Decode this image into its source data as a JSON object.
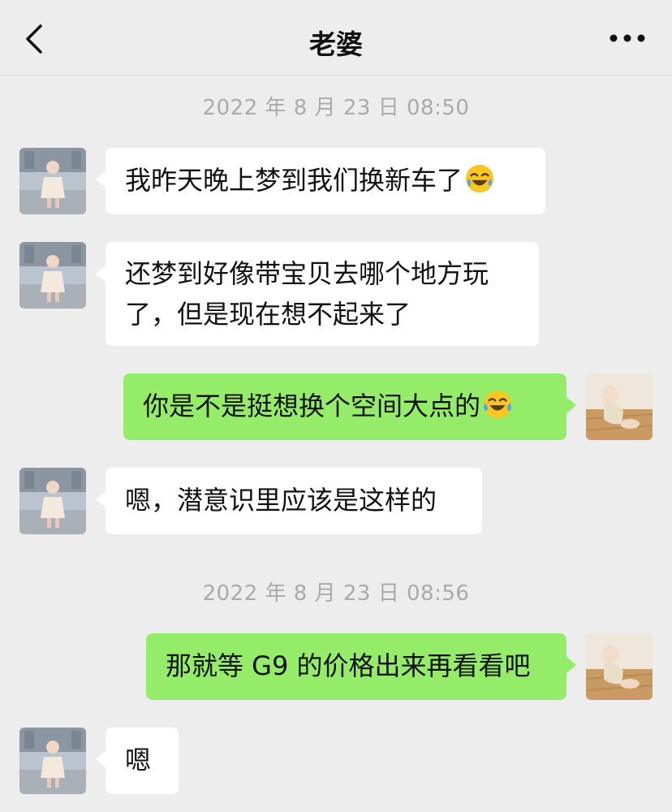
{
  "header": {
    "title": "老婆",
    "back_icon": "chevron-left-icon",
    "more_icon": "more-dots-icon"
  },
  "messages": [
    {
      "type": "timestamp",
      "text": "2022 年 8 月 23 日  08:50"
    },
    {
      "type": "received",
      "text": "我昨天晚上梦到我们换新车了",
      "emoji": "laughing-crying-emoji"
    },
    {
      "type": "received",
      "line1": "还梦到好像带宝贝去哪个地方玩",
      "line2": "了，但是现在想不起来了"
    },
    {
      "type": "sent",
      "text": "你是不是挺想换个空间大点的",
      "emoji": "tears-of-joy-emoji"
    },
    {
      "type": "received",
      "text": "嗯，潜意识里应该是这样的"
    },
    {
      "type": "timestamp",
      "text": "2022 年 8 月 23 日  08:56"
    },
    {
      "type": "sent",
      "text": "那就等 G9 的价格出来再看看吧"
    },
    {
      "type": "received",
      "text": "嗯"
    }
  ],
  "colors": {
    "background": "#ededed",
    "sent_bubble": "#95ec69",
    "received_bubble": "#ffffff",
    "timestamp": "#aaaaaa"
  }
}
